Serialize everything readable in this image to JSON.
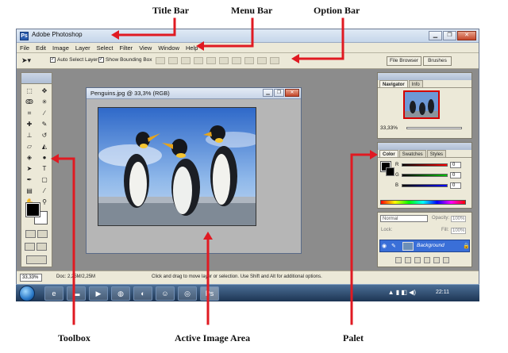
{
  "annotations": {
    "title_bar": "Title Bar",
    "menu_bar": "Menu Bar",
    "option_bar": "Option Bar",
    "toolbox": "Toolbox",
    "active_image_area": "Active Image Area",
    "palet": "Palet"
  },
  "colors": {
    "arrow": "#e01a22",
    "desktop_gray": "#8c8c8c",
    "layer_highlight": "#3a6fd8"
  },
  "app": {
    "title": "Adobe Photoshop",
    "window_buttons": [
      "minimize-icon",
      "restore-icon",
      "close-icon"
    ]
  },
  "menu": [
    "File",
    "Edit",
    "Image",
    "Layer",
    "Select",
    "Filter",
    "View",
    "Window",
    "Help"
  ],
  "options": {
    "auto_select_layer": "Auto Select Layer",
    "show_bounding_box": "Show Bounding Box",
    "file_browser_tab": "File Browser",
    "brushes_tab": "Brushes"
  },
  "document": {
    "title": "Penguins.jpg @ 33,3% (RGB)"
  },
  "navigator": {
    "tabs": [
      "Navigator",
      "Info"
    ],
    "zoom": "33,33%"
  },
  "color_panel": {
    "tabs": [
      "Color",
      "Swatches",
      "Styles"
    ],
    "channels": [
      {
        "label": "R",
        "value": "0"
      },
      {
        "label": "G",
        "value": "0"
      },
      {
        "label": "B",
        "value": "0"
      }
    ]
  },
  "layers": {
    "blend_mode": "Normal",
    "opacity_label": "Opacity:",
    "opacity": "100%",
    "lock_label": "Lock:",
    "fill_label": "Fill:",
    "fill": "100%",
    "layer_name": "Background"
  },
  "status": {
    "zoom": "33,33%",
    "doc_size": "Doc: 2,25M/2,25M",
    "hint": "Click and drag to move layer or selection.  Use Shift and Alt for additional options."
  },
  "taskbar": {
    "clock": "22:11"
  }
}
